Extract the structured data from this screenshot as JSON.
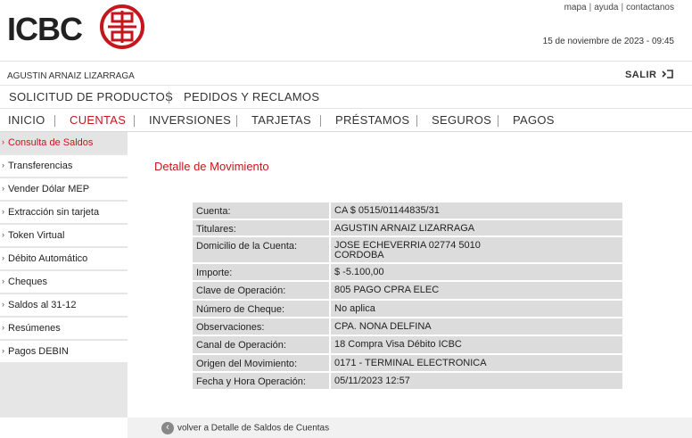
{
  "brand": {
    "name": "ICBC",
    "logo_icon": "icbc-logo-icon",
    "accent": "#c4161c"
  },
  "toplinks": [
    "mapa",
    "ayuda",
    "contactanos"
  ],
  "datetime": "15 de noviembre de 2023 - 09:45",
  "user": {
    "name": "AGUSTIN ARNAIZ LIZARRAGA",
    "logout_label": "SALIR",
    "logout_icon": "logout-icon"
  },
  "topmenu": [
    "SOLICITUD DE PRODUCTOS",
    "PEDIDOS Y RECLAMOS"
  ],
  "mainnav": [
    "INICIO",
    "CUENTAS",
    "INVERSIONES",
    "TARJETAS",
    "PRÉSTAMOS",
    "SEGUROS",
    "PAGOS"
  ],
  "sidebar": [
    "Consulta de Saldos",
    "Transferencias",
    "Vender Dólar MEP",
    "Extracción sin tarjeta",
    "Token Virtual",
    "Débito Automático",
    "Cheques",
    "Saldos al 31-12",
    "Resúmenes",
    "Pagos DEBIN"
  ],
  "detail": {
    "title": "Detalle de Movimiento",
    "rows": [
      {
        "label": "Cuenta:",
        "value": "CA $ 0515/01144835/31"
      },
      {
        "label": "Titulares:",
        "value": "AGUSTIN ARNAIZ LIZARRAGA"
      },
      {
        "label": "Domicilio de la Cuenta:",
        "value": "JOSE ECHEVERRIA 02774 5010",
        "value2": "CORDOBA"
      },
      {
        "label": "Importe:",
        "value": "$ -5.100,00"
      },
      {
        "label": "Clave de Operación:",
        "value": "805 PAGO CPRA ELEC"
      },
      {
        "label": "Número de Cheque:",
        "value": "No aplica"
      },
      {
        "label": "Observaciones:",
        "value": "CPA. NONA DELFINA"
      },
      {
        "label": "Canal de Operación:",
        "value": "18 Compra Visa Débito ICBC"
      },
      {
        "label": "Origen del Movimiento:",
        "value": "0171 - TERMINAL ELECTRONICA"
      },
      {
        "label": "Fecha y Hora Operación:",
        "value": "05/11/2023 12:57"
      }
    ]
  },
  "back": {
    "label": "volver a Detalle de Saldos de Cuentas",
    "icon": "chevron-left-icon"
  }
}
